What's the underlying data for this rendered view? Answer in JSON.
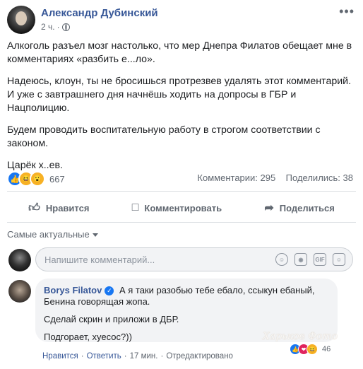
{
  "post": {
    "author": "Александр Дубинский",
    "time": "2 ч.",
    "separator": "·",
    "more": "•••",
    "paragraphs": [
      "Алкоголь разъел мозг настолько, что мер Днепра Филатов обещает мне в комментариях «разбить е...ло».",
      "Надеюсь, клоун, ты не бросишься протрезвев удалять этот комментарий. И уже с завтрашнего дня начнёшь ходить на допросы в ГБР и Нацполицию.",
      "Будем проводить воспитательную работу в строгом соответствии с законом.",
      "Царёк х..ев."
    ],
    "reactions_count": "667",
    "comments_label": "Комментарии: 295",
    "shares_label": "Поделились: 38"
  },
  "actions": {
    "like": "Нравится",
    "comment": "Комментировать",
    "share": "Поделиться"
  },
  "comments": {
    "sort_label": "Самые актуальные",
    "input_placeholder": "Напишите комментарий...",
    "input_icons": [
      "emoji-icon",
      "camera-icon",
      "gif-icon",
      "sticker-icon"
    ],
    "gif_label": "GIF",
    "items": [
      {
        "author": "Borys Filatov",
        "lines": [
          "А я таки разобью тебе ебало, ссыкун ебаный, Бенина говорящая жопа.",
          "Сделай скрин и приложи в ДБР.",
          "Подгорает, хуесос?))"
        ],
        "reactions_count": "46",
        "like_label": "Нравится",
        "reply_label": "Ответить",
        "time": "17 мин.",
        "edited": "Отредактировано",
        "dot": "·"
      }
    ]
  },
  "watermark": "Харьков Фото",
  "colors": {
    "link": "#385898",
    "accent": "#1877f2",
    "muted": "#606770"
  }
}
